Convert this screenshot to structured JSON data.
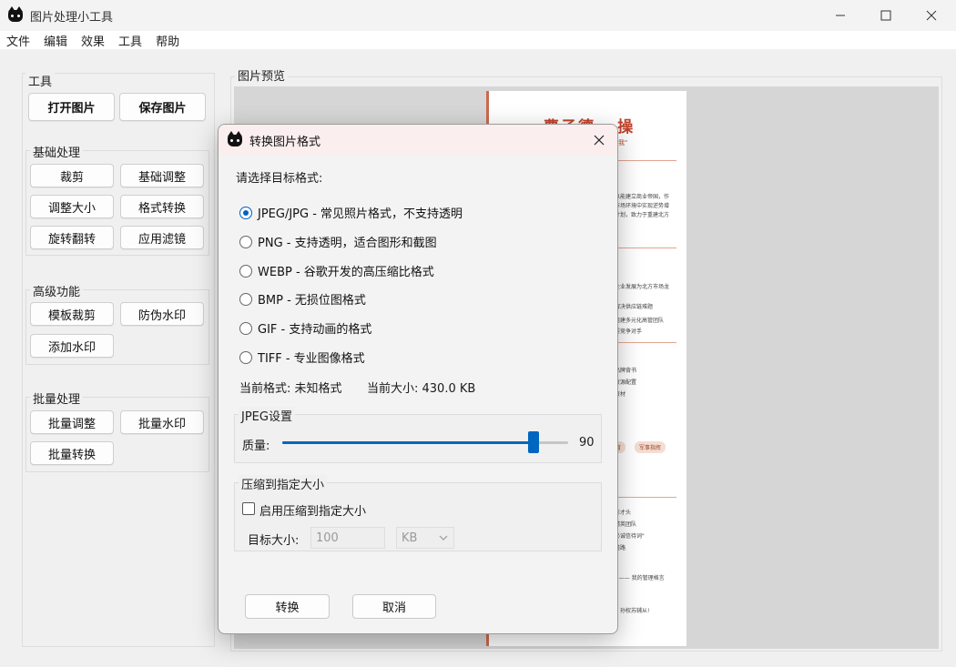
{
  "window": {
    "title": "图片处理小工具"
  },
  "menu": [
    "文件",
    "编辑",
    "效果",
    "工具",
    "帮助"
  ],
  "tools": {
    "title": "工具",
    "open_label": "打开图片",
    "save_label": "保存图片",
    "basic": {
      "title": "基础处理",
      "crop": "裁剪",
      "adjust": "基础调整",
      "resize": "调整大小",
      "convert": "格式转换",
      "rotate": "旋转翻转",
      "filter": "应用滤镜"
    },
    "advanced": {
      "title": "高级功能",
      "template_crop": "模板裁剪",
      "anti_fake": "防伪水印",
      "add_watermark": "添加水印"
    },
    "batch": {
      "title": "批量处理",
      "adjust": "批量调整",
      "watermark": "批量水印",
      "convert": "批量转换"
    }
  },
  "preview": {
    "title": "图片预览",
    "doc_title": "曹子德 · 操",
    "doc_subtitle": "人负我\"",
    "doc_tags": [
      "育",
      "军事指挥"
    ],
    "doc_lines": [
      "以能建立商业帝国，作",
      "市场环境中实现逆势增",
      "计划，致力于重建北方",
      "企业发展为北方市场龙",
      "解决供应链难题",
      "组建多元化高管团队",
      "要竞争对手",
      "品牌背书",
      "资源配置",
      "资材",
      "引才头",
      "精英团队",
      "必诚信待词\"",
      "道路",
      "\" —— 我的管理格言",
      "，孙权苏辅从!"
    ]
  },
  "dialog": {
    "title": "转换图片格式",
    "prompt": "请选择目标格式:",
    "formats": [
      {
        "label": "JPEG/JPG - 常见照片格式，不支持透明",
        "checked": true
      },
      {
        "label": "PNG - 支持透明，适合图形和截图",
        "checked": false
      },
      {
        "label": "WEBP - 谷歌开发的高压缩比格式",
        "checked": false
      },
      {
        "label": "BMP - 无损位图格式",
        "checked": false
      },
      {
        "label": "GIF - 支持动画的格式",
        "checked": false
      },
      {
        "label": "TIFF - 专业图像格式",
        "checked": false
      }
    ],
    "current_format": "当前格式: 未知格式",
    "current_size": "当前大小: 430.0 KB",
    "jpeg_settings": {
      "title": "JPEG设置",
      "quality_label": "质量:",
      "quality_value": "90",
      "quality_fraction": 0.88
    },
    "compress": {
      "title": "压缩到指定大小",
      "enable_label": "启用压缩到指定大小",
      "target_label": "目标大小:",
      "target_value": "100",
      "unit": "KB"
    },
    "convert_label": "转换",
    "cancel_label": "取消"
  },
  "colors": {
    "accent": "#0067c0",
    "doc_accent": "#c0432a",
    "dialog_title_bg": "#fbeeee"
  }
}
